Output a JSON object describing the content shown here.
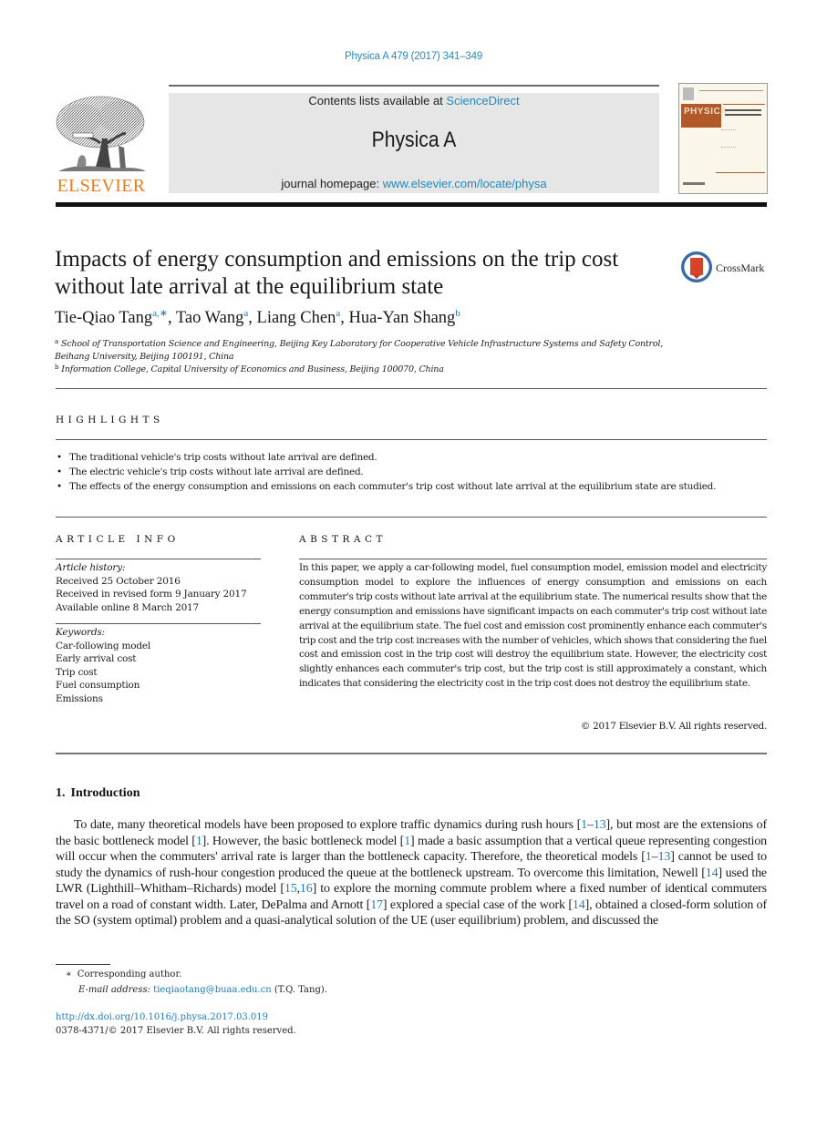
{
  "header": {
    "journal_reference": "Physica A 479 (2017) 341–349",
    "contents_prefix": "Contents lists available at ",
    "contents_link": "ScienceDirect",
    "journal_name": "Physica A",
    "homepage_prefix": "journal homepage: ",
    "homepage_link": "www.elsevier.com/locate/physa",
    "publisher_wordmark": "ELSEVIER",
    "cover_title": "PHYSICA",
    "crossmark_label": "CrossMark",
    "brand_color": "#f07b1d",
    "link_color": "#1f7bb8"
  },
  "article": {
    "title": "Impacts of energy consumption and emissions on the trip cost without late arrival at the equilibrium state",
    "authors": [
      {
        "name": "Tie-Qiao Tang",
        "affil": "a,∗"
      },
      {
        "name": "Tao Wang",
        "affil": "a"
      },
      {
        "name": "Liang Chen",
        "affil": "a"
      },
      {
        "name": "Hua-Yan Shang",
        "affil": "b"
      }
    ],
    "affiliations": [
      {
        "mark": "a",
        "text": "School of Transportation Science and Engineering, Beijing Key Laboratory for Cooperative Vehicle Infrastructure Systems and Safety Control, Beihang University, Beijing 100191, China"
      },
      {
        "mark": "b",
        "text": "Information College, Capital University of Economics and Business, Beijing 100070, China"
      }
    ]
  },
  "highlights": {
    "heading": "HIGHLIGHTS",
    "bullet": "•",
    "items": [
      "The traditional vehicle's trip costs without late arrival are defined.",
      "The electric vehicle's trip costs without late arrival are defined.",
      "The effects of the energy consumption and emissions on each commuter's trip cost without late arrival at the equilibrium state are studied."
    ]
  },
  "article_info": {
    "heading": "ARTICLE INFO",
    "history_label": "Article history:",
    "history": [
      "Received 25 October 2016",
      "Received in revised form 9 January 2017",
      "Available online 8 March 2017"
    ],
    "keywords_label": "Keywords:",
    "keywords": [
      "Car-following model",
      "Early arrival cost",
      "Trip cost",
      "Fuel consumption",
      "Emissions"
    ]
  },
  "abstract": {
    "heading": "ABSTRACT",
    "text": "In this paper, we apply a car-following model, fuel consumption model, emission model and electricity consumption model to explore the influences of energy consumption and emissions on each commuter's trip costs without late arrival at the equilibrium state. The numerical results show that the energy consumption and emissions have significant impacts on each commuter's trip cost without late arrival at the equilibrium state. The fuel cost and emission cost prominently enhance each commuter's trip cost and the trip cost increases with the number of vehicles, which shows that considering the fuel cost and emission cost in the trip cost will destroy the equilibrium state. However, the electricity cost slightly enhances each commuter's trip cost, but the trip cost is still approximately a constant, which indicates that considering the electricity cost in the trip cost does not destroy the equilibrium state.",
    "copyright": "© 2017 Elsevier B.V. All rights reserved."
  },
  "introduction": {
    "number": "1.",
    "heading": "Introduction",
    "segments": [
      {
        "t": "To date, many theoretical models have been proposed to explore traffic dynamics during rush hours ["
      },
      {
        "c": "1"
      },
      {
        "t": "–"
      },
      {
        "c": "13"
      },
      {
        "t": "], but most are the extensions of the basic bottleneck model ["
      },
      {
        "c": "1"
      },
      {
        "t": "]. However, the basic bottleneck model ["
      },
      {
        "c": "1"
      },
      {
        "t": "] made a basic assumption that a vertical queue representing congestion will occur when the commuters' arrival rate is larger than the bottleneck capacity. Therefore, the theoretical models ["
      },
      {
        "c": "1"
      },
      {
        "t": "–"
      },
      {
        "c": "13"
      },
      {
        "t": "] cannot be used to study the dynamics of rush-hour congestion produced the queue at the bottleneck upstream. To overcome this limitation, Newell ["
      },
      {
        "c": "14"
      },
      {
        "t": "] used the LWR (Lighthill–Whitham–Richards) model ["
      },
      {
        "c": "15"
      },
      {
        "t": ","
      },
      {
        "c": "16"
      },
      {
        "t": "] to explore the morning commute problem where a fixed number of identical commuters travel on a road of constant width. Later, DePalma and Arnott ["
      },
      {
        "c": "17"
      },
      {
        "t": "] explored a special case of the work ["
      },
      {
        "c": "14"
      },
      {
        "t": "], obtained a closed-form solution of the SO (system optimal) problem and a quasi-analytical solution of the UE (user equilibrium) problem, and discussed the"
      }
    ]
  },
  "footnotes": {
    "star": "∗",
    "corresponding": "Corresponding author.",
    "email_label": "E-mail address:",
    "email": "tieqiaotang@buaa.edu.cn",
    "email_suffix": " (T.Q. Tang).",
    "doi": "http://dx.doi.org/10.1016/j.physa.2017.03.019",
    "issn": "0378-4371/© 2017 Elsevier B.V. All rights reserved."
  }
}
